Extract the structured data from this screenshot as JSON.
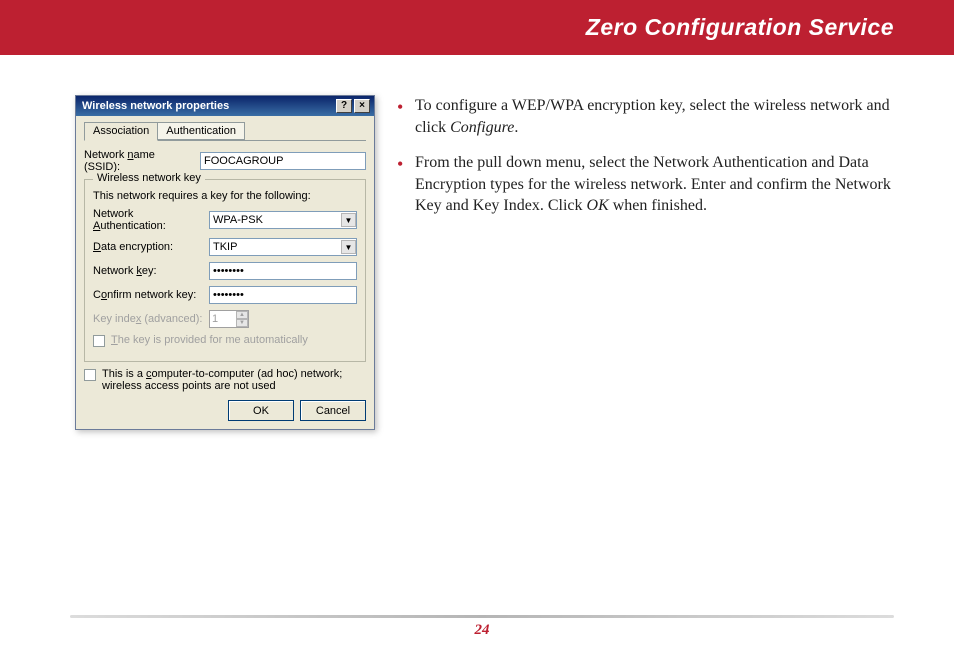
{
  "header": {
    "title": "Zero Configuration Service"
  },
  "dialog": {
    "title": "Wireless network properties",
    "help_btn": "?",
    "close_btn": "×",
    "tabs": {
      "association": "Association",
      "authentication": "Authentication"
    },
    "ssid_label_pre": "Network ",
    "ssid_label_u": "n",
    "ssid_label_post": "ame (SSID):",
    "ssid_value": "FOOCAGROUP",
    "group_title": "Wireless network key",
    "group_desc": "This network requires a key for the following:",
    "auth_label_pre": "Network ",
    "auth_label_u": "A",
    "auth_label_post": "uthentication:",
    "auth_value": "WPA-PSK",
    "enc_label_u": "D",
    "enc_label_post": "ata encryption:",
    "enc_value": "TKIP",
    "key_label_pre": "Network ",
    "key_label_u": "k",
    "key_label_post": "ey:",
    "key_value": "••••••••",
    "confirm_label_pre": "C",
    "confirm_label_u": "o",
    "confirm_label_post": "nfirm network key:",
    "confirm_value": "••••••••",
    "keyidx_label_pre": "Key inde",
    "keyidx_label_u": "x",
    "keyidx_label_post": " (advanced):",
    "keyidx_value": "1",
    "auto_label_u": "T",
    "auto_label_post": "he key is provided for me automatically",
    "adhoc_label_pre": "This is a ",
    "adhoc_label_u": "c",
    "adhoc_label_post": "omputer-to-computer (ad hoc) network; wireless access points are not used",
    "ok": "OK",
    "cancel": "Cancel"
  },
  "instructions": {
    "b1_a": "To configure a WEP/WPA encryption key, select the wireless network and click ",
    "b1_i": "Configure",
    "b1_b": ".",
    "b2_a": "From the pull down menu, select the Network Authentication and Data Encryption types for the wireless network.  Enter and confirm the Network Key and Key Index.  Click ",
    "b2_i": "OK",
    "b2_b": " when finished."
  },
  "page_number": "24"
}
